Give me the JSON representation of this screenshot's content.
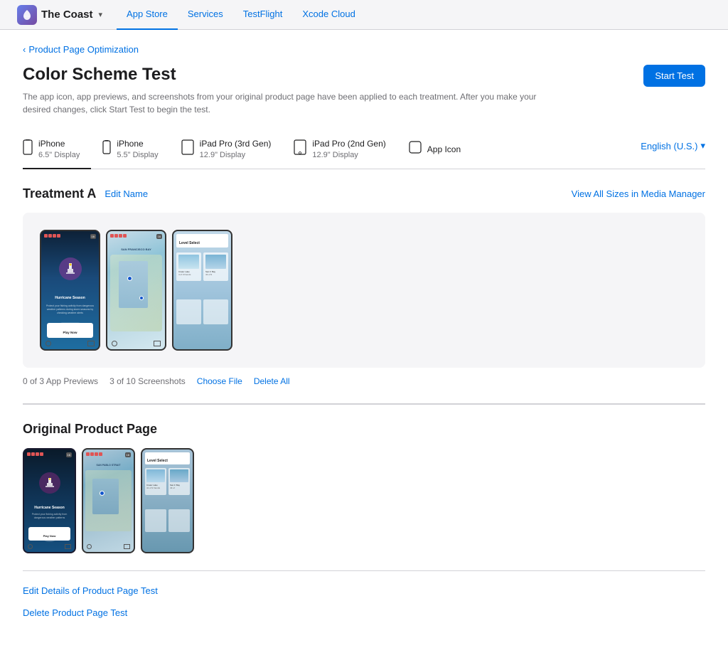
{
  "app": {
    "logo_letter": "🌊",
    "name": "The Coast",
    "chevron": "▾"
  },
  "nav": {
    "tabs": [
      {
        "id": "app-store",
        "label": "App Store",
        "active": true
      },
      {
        "id": "services",
        "label": "Services",
        "active": false
      },
      {
        "id": "testflight",
        "label": "TestFlight",
        "active": false
      },
      {
        "id": "xcode-cloud",
        "label": "Xcode Cloud",
        "active": false
      }
    ]
  },
  "breadcrumb": {
    "arrow": "‹",
    "label": "Product Page Optimization"
  },
  "header": {
    "title": "Color Scheme Test",
    "description": "The app icon, app previews, and screenshots from your original product page have been applied to each treatment. After you make your desired changes, click Start Test to begin the test.",
    "start_test_label": "Start Test"
  },
  "device_tabs": [
    {
      "id": "iphone-65",
      "icon": "📱",
      "name": "iPhone",
      "size": "6.5\" Display",
      "active": true
    },
    {
      "id": "iphone-55",
      "icon": "📱",
      "name": "iPhone",
      "size": "5.5\" Display",
      "active": false
    },
    {
      "id": "ipad-pro-3rd",
      "icon": "⬜",
      "name": "iPad Pro (3rd Gen)",
      "size": "12.9\" Display",
      "active": false
    },
    {
      "id": "ipad-pro-2nd",
      "icon": "⬜",
      "name": "iPad Pro (2nd Gen)",
      "size": "12.9\" Display",
      "active": false
    },
    {
      "id": "app-icon",
      "icon": "⬜",
      "name": "App Icon",
      "size": "",
      "active": false
    }
  ],
  "language": {
    "label": "English (U.S.)",
    "chevron": "▾"
  },
  "treatment_a": {
    "title": "Treatment A",
    "edit_name_label": "Edit Name",
    "view_all_label": "View All Sizes in Media Manager",
    "app_previews_count": "0 of 3 App Previews",
    "screenshots_count": "3  of 10 Screenshots",
    "choose_file_label": "Choose File",
    "delete_all_label": "Delete All"
  },
  "original": {
    "title": "Original Product Page"
  },
  "bottom_links": [
    {
      "id": "edit-details",
      "label": "Edit Details of Product Page Test"
    },
    {
      "id": "delete-test",
      "label": "Delete Product Page Test"
    }
  ]
}
